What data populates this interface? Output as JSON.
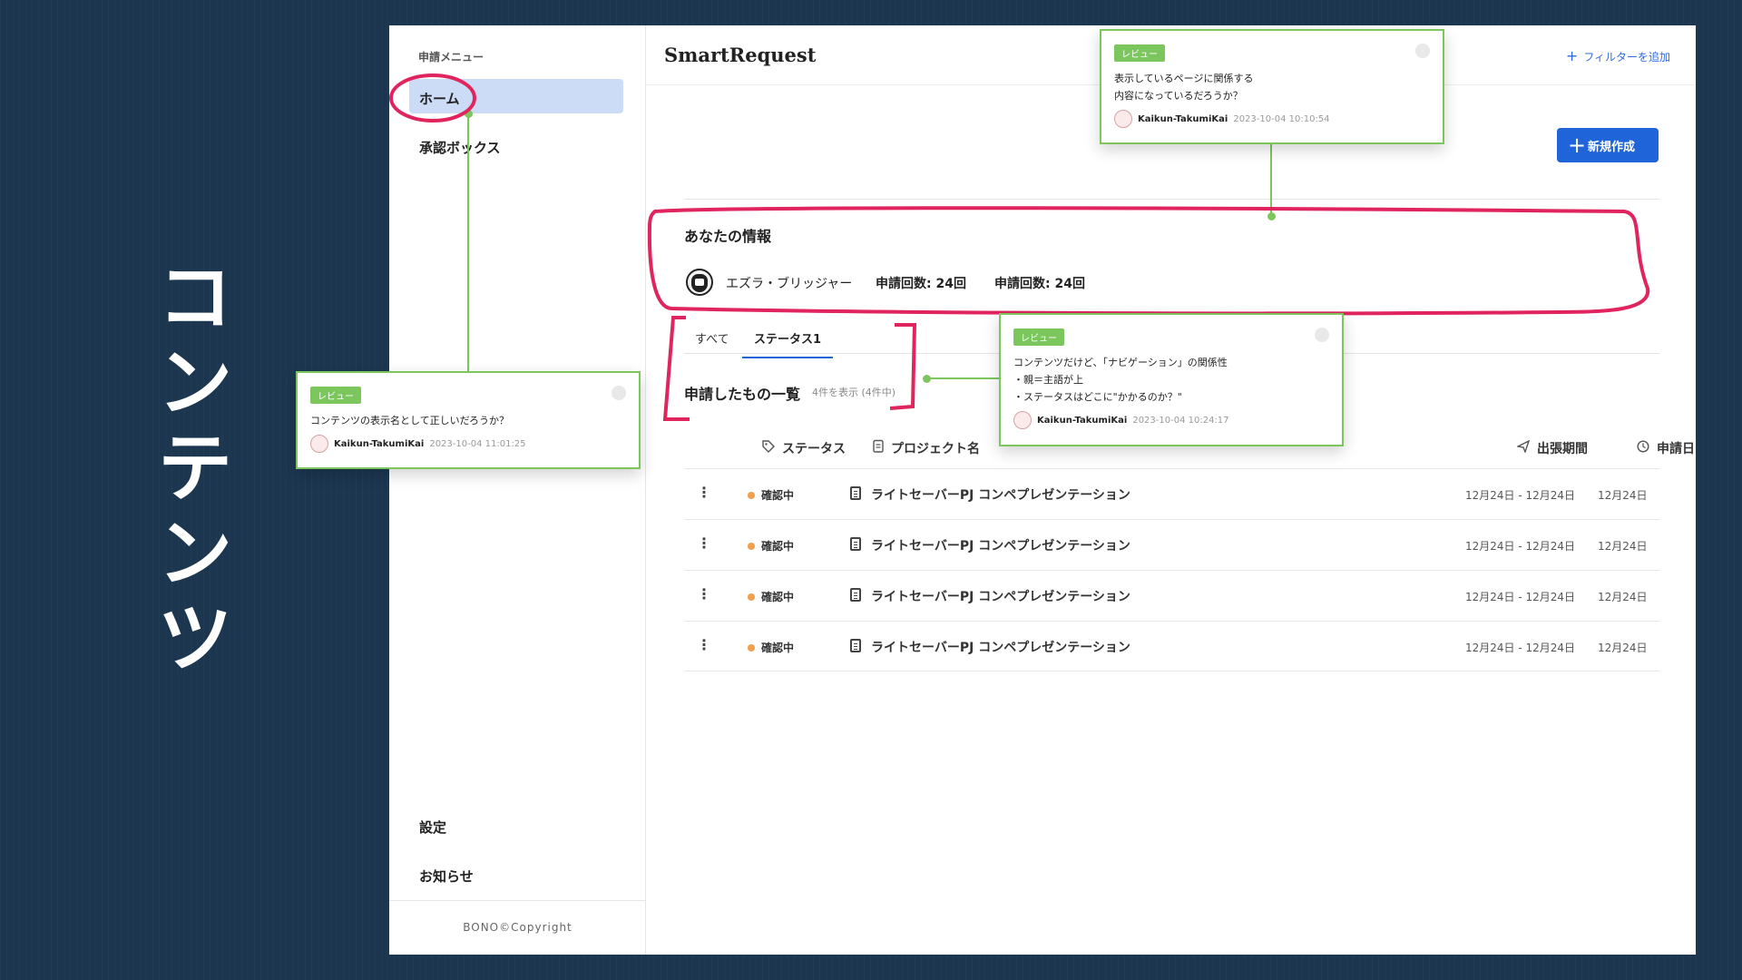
{
  "slide_title": "コンテンツ",
  "sidebar": {
    "menu_header": "申請メニュー",
    "items": [
      {
        "label": "ホーム"
      },
      {
        "label": "承認ボックス"
      }
    ],
    "bottom_items": [
      {
        "label": "設定"
      },
      {
        "label": "お知らせ"
      }
    ],
    "copyright": "BONO©Copyright"
  },
  "header": {
    "title": "SmartRequest",
    "filter_label": "フィルターを追加",
    "new_label": "新規作成"
  },
  "user_info": {
    "heading": "あなたの情報",
    "name": "エズラ・ブリッジャー",
    "count1": "申請回数: 24回",
    "count2": "申請回数: 24回"
  },
  "tabs": [
    {
      "label": "すべて"
    },
    {
      "label": "ステータス1"
    }
  ],
  "list": {
    "title": "申請したもの一覧",
    "count": "4件を表示 (4件中)",
    "columns": {
      "status": "ステータス",
      "project": "プロジェクト名",
      "trip": "出張期間",
      "date": "申請日"
    },
    "rows": [
      {
        "status": "確認中",
        "project": "ライトセーバーPJ コンペプレゼンテーション",
        "trip": "12月24日 - 12月24日",
        "date": "12月24日"
      },
      {
        "status": "確認中",
        "project": "ライトセーバーPJ コンペプレゼンテーション",
        "trip": "12月24日 - 12月24日",
        "date": "12月24日"
      },
      {
        "status": "確認中",
        "project": "ライトセーバーPJ コンペプレゼンテーション",
        "trip": "12月24日 - 12月24日",
        "date": "12月24日"
      },
      {
        "status": "確認中",
        "project": "ライトセーバーPJ コンペプレゼンテーション",
        "trip": "12月24日 - 12月24日",
        "date": "12月24日"
      }
    ]
  },
  "reviews": [
    {
      "badge": "レビュー",
      "text": "表示しているページに関係する\n内容になっているだろうか？",
      "user": "Kaikun-TakumiKai",
      "time": "2023-10-04 10:10:54"
    },
    {
      "badge": "レビュー",
      "text": "コンテンツの表示名として正しいだろうか？",
      "user": "Kaikun-TakumiKai",
      "time": "2023-10-04 11:01:25"
    },
    {
      "badge": "レビュー",
      "text": "コンテンツだけど、「ナビゲーション」の関係性\n・親＝主語が上\n・ステータスはどこに\"かかるのか？\"",
      "user": "Kaikun-TakumiKai",
      "time": "2023-10-04 10:24:17"
    }
  ],
  "colors": {
    "accent": "#1f64d9",
    "status_dot": "#f0a04b",
    "review_green": "#7cc65e",
    "highlight_red": "#e0245e",
    "background": "#1c3650"
  },
  "icons": {
    "status_column": "tag-icon",
    "project_column": "clipboard-icon",
    "trip_column": "airplane-icon",
    "date_column": "clock-icon"
  }
}
